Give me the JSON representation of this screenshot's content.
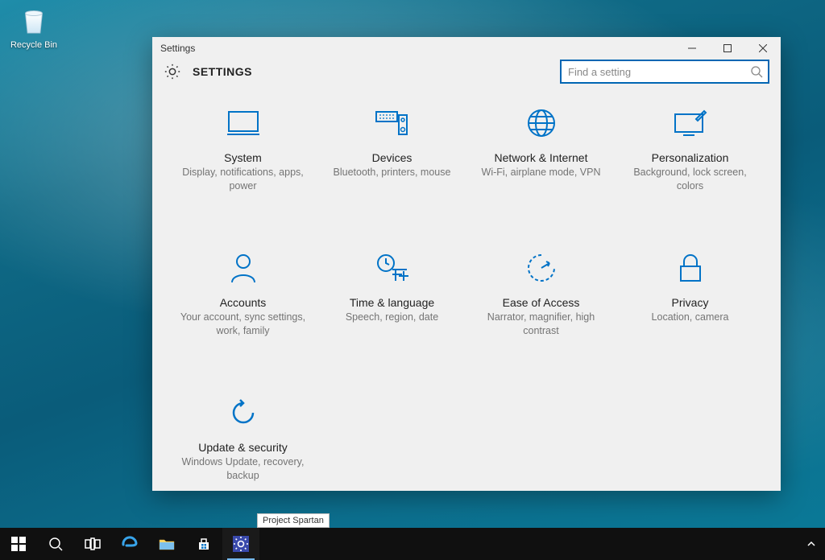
{
  "desktop": {
    "recycle_bin_label": "Recycle Bin"
  },
  "window": {
    "title": "Settings",
    "header": "SETTINGS",
    "search_placeholder": "Find a setting"
  },
  "tiles": [
    {
      "title": "System",
      "sub": "Display, notifications, apps, power"
    },
    {
      "title": "Devices",
      "sub": "Bluetooth, printers, mouse"
    },
    {
      "title": "Network & Internet",
      "sub": "Wi-Fi, airplane mode, VPN"
    },
    {
      "title": "Personalization",
      "sub": "Background, lock screen, colors"
    },
    {
      "title": "Accounts",
      "sub": "Your account, sync settings, work, family"
    },
    {
      "title": "Time & language",
      "sub": "Speech, region, date"
    },
    {
      "title": "Ease of Access",
      "sub": "Narrator, magnifier, high contrast"
    },
    {
      "title": "Privacy",
      "sub": "Location, camera"
    },
    {
      "title": "Update & security",
      "sub": "Windows Update, recovery, backup"
    }
  ],
  "tooltip": "Project Spartan",
  "accent": "#0173c7"
}
